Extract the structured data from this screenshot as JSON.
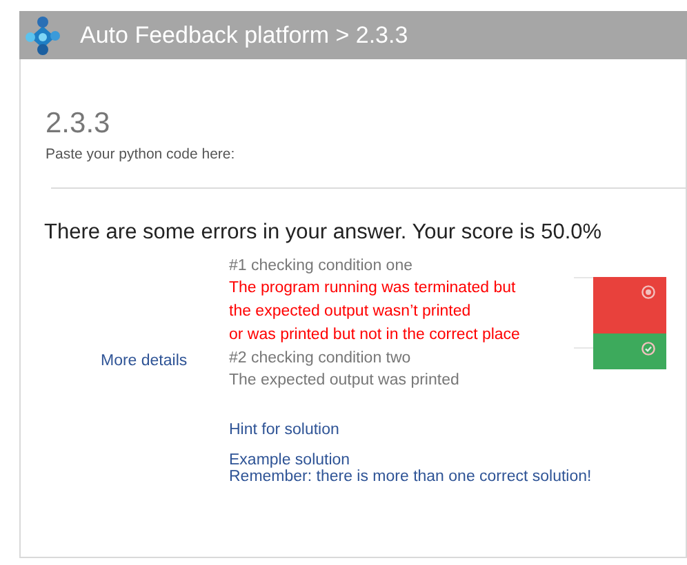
{
  "header": {
    "title": "Auto Feedback platform > 2.3.3"
  },
  "exercise": {
    "title": "2.3.3",
    "instruction": "Paste your python code here:"
  },
  "result": {
    "summary": "There are some errors in your answer. Your score is 50.0%"
  },
  "more_details": "More details",
  "conditions": [
    {
      "title": "#1 checking condition one",
      "passed": false,
      "message": [
        "The program running was terminated but",
        "the expected output wasn’t printed",
        "or was printed but not in the correct place"
      ]
    },
    {
      "title": "#2 checking condition two",
      "passed": true,
      "message": [
        "The expected output was printed"
      ]
    }
  ],
  "hint": "Hint for solution",
  "example": {
    "link": "Example solution",
    "note": "Remember: there is more than one correct solution!"
  }
}
